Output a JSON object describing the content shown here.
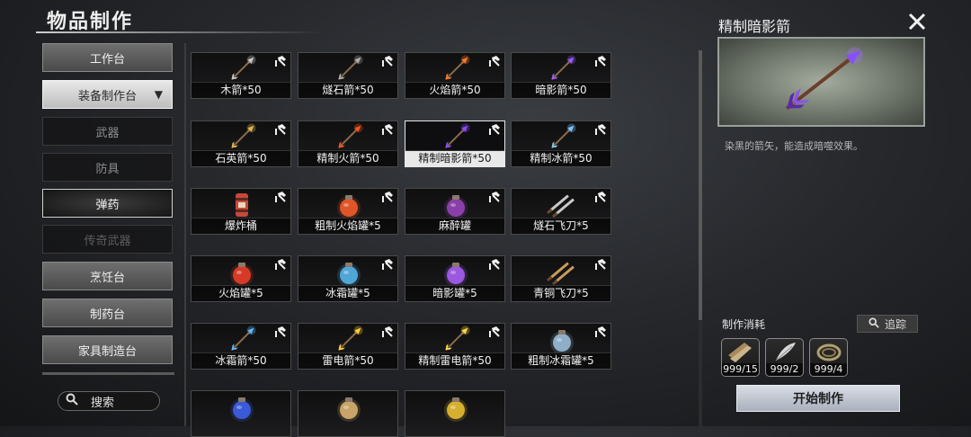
{
  "header": {
    "title": "物品制作"
  },
  "sidebar": {
    "items": [
      {
        "label": "工作台",
        "kind": "cat"
      },
      {
        "label": "装备制作台",
        "kind": "open"
      },
      {
        "label": "武器",
        "kind": "sub"
      },
      {
        "label": "防具",
        "kind": "sub"
      },
      {
        "label": "弹药",
        "kind": "sub active"
      },
      {
        "label": "传奇武器",
        "kind": "sub dim"
      },
      {
        "label": "烹饪台",
        "kind": "cat"
      },
      {
        "label": "制药台",
        "kind": "cat"
      },
      {
        "label": "家具制造台",
        "kind": "cat"
      }
    ],
    "search_label": "搜索"
  },
  "grid": {
    "items": [
      {
        "label": "木箭*50",
        "icon": "arrow",
        "color": "#c9c9c9"
      },
      {
        "label": "燧石箭*50",
        "icon": "arrow",
        "color": "#b0b0b0"
      },
      {
        "label": "火焰箭*50",
        "icon": "arrow",
        "color": "#ff7a2a"
      },
      {
        "label": "暗影箭*50",
        "icon": "arrow",
        "color": "#a05cff"
      },
      {
        "label": "石英箭*50",
        "icon": "arrow",
        "color": "#e2b84a"
      },
      {
        "label": "精制火箭*50",
        "icon": "arrow",
        "color": "#ff5522"
      },
      {
        "label": "精制暗影箭*50",
        "icon": "arrow",
        "color": "#8a4cff",
        "selected": true
      },
      {
        "label": "精制冰箭*50",
        "icon": "arrow",
        "color": "#7fc8ff"
      },
      {
        "label": "爆炸桶",
        "icon": "barrel",
        "color": "#c8483a"
      },
      {
        "label": "粗制火焰罐*5",
        "icon": "jar",
        "color": "#e0562a"
      },
      {
        "label": "麻醉罐",
        "icon": "jar",
        "color": "#8a3fa8"
      },
      {
        "label": "燧石飞刀*5",
        "icon": "knives",
        "color": "#c9c9c9"
      },
      {
        "label": "火焰罐*5",
        "icon": "jar",
        "color": "#d63a2a"
      },
      {
        "label": "冰霜罐*5",
        "icon": "jar",
        "color": "#4fa7d8"
      },
      {
        "label": "暗影罐*5",
        "icon": "jar",
        "color": "#9b58e0"
      },
      {
        "label": "青铜飞刀*5",
        "icon": "knives",
        "color": "#c99b5a"
      },
      {
        "label": "冰霜箭*50",
        "icon": "arrow",
        "color": "#5fb8ff"
      },
      {
        "label": "雷电箭*50",
        "icon": "arrow",
        "color": "#ffd23a"
      },
      {
        "label": "精制雷电箭*50",
        "icon": "arrow",
        "color": "#ffd84a"
      },
      {
        "label": "粗制冰霜罐*5",
        "icon": "jar",
        "color": "#8fb0c8"
      },
      {
        "label": "",
        "icon": "jar",
        "color": "#3a5ad8"
      },
      {
        "label": "",
        "icon": "jar",
        "color": "#c9a46a"
      },
      {
        "label": "",
        "icon": "jar",
        "color": "#d8b030"
      }
    ]
  },
  "detail": {
    "title": "精制暗影箭",
    "description": "染黑的箭矢，能造成暗噬效果。",
    "materials_title": "制作消耗",
    "track_label": "追踪",
    "materials": [
      {
        "count": "999/15",
        "icon": "wood-planks"
      },
      {
        "count": "999/2",
        "icon": "feather"
      },
      {
        "count": "999/4",
        "icon": "rope"
      }
    ],
    "start_label": "开始制作"
  }
}
